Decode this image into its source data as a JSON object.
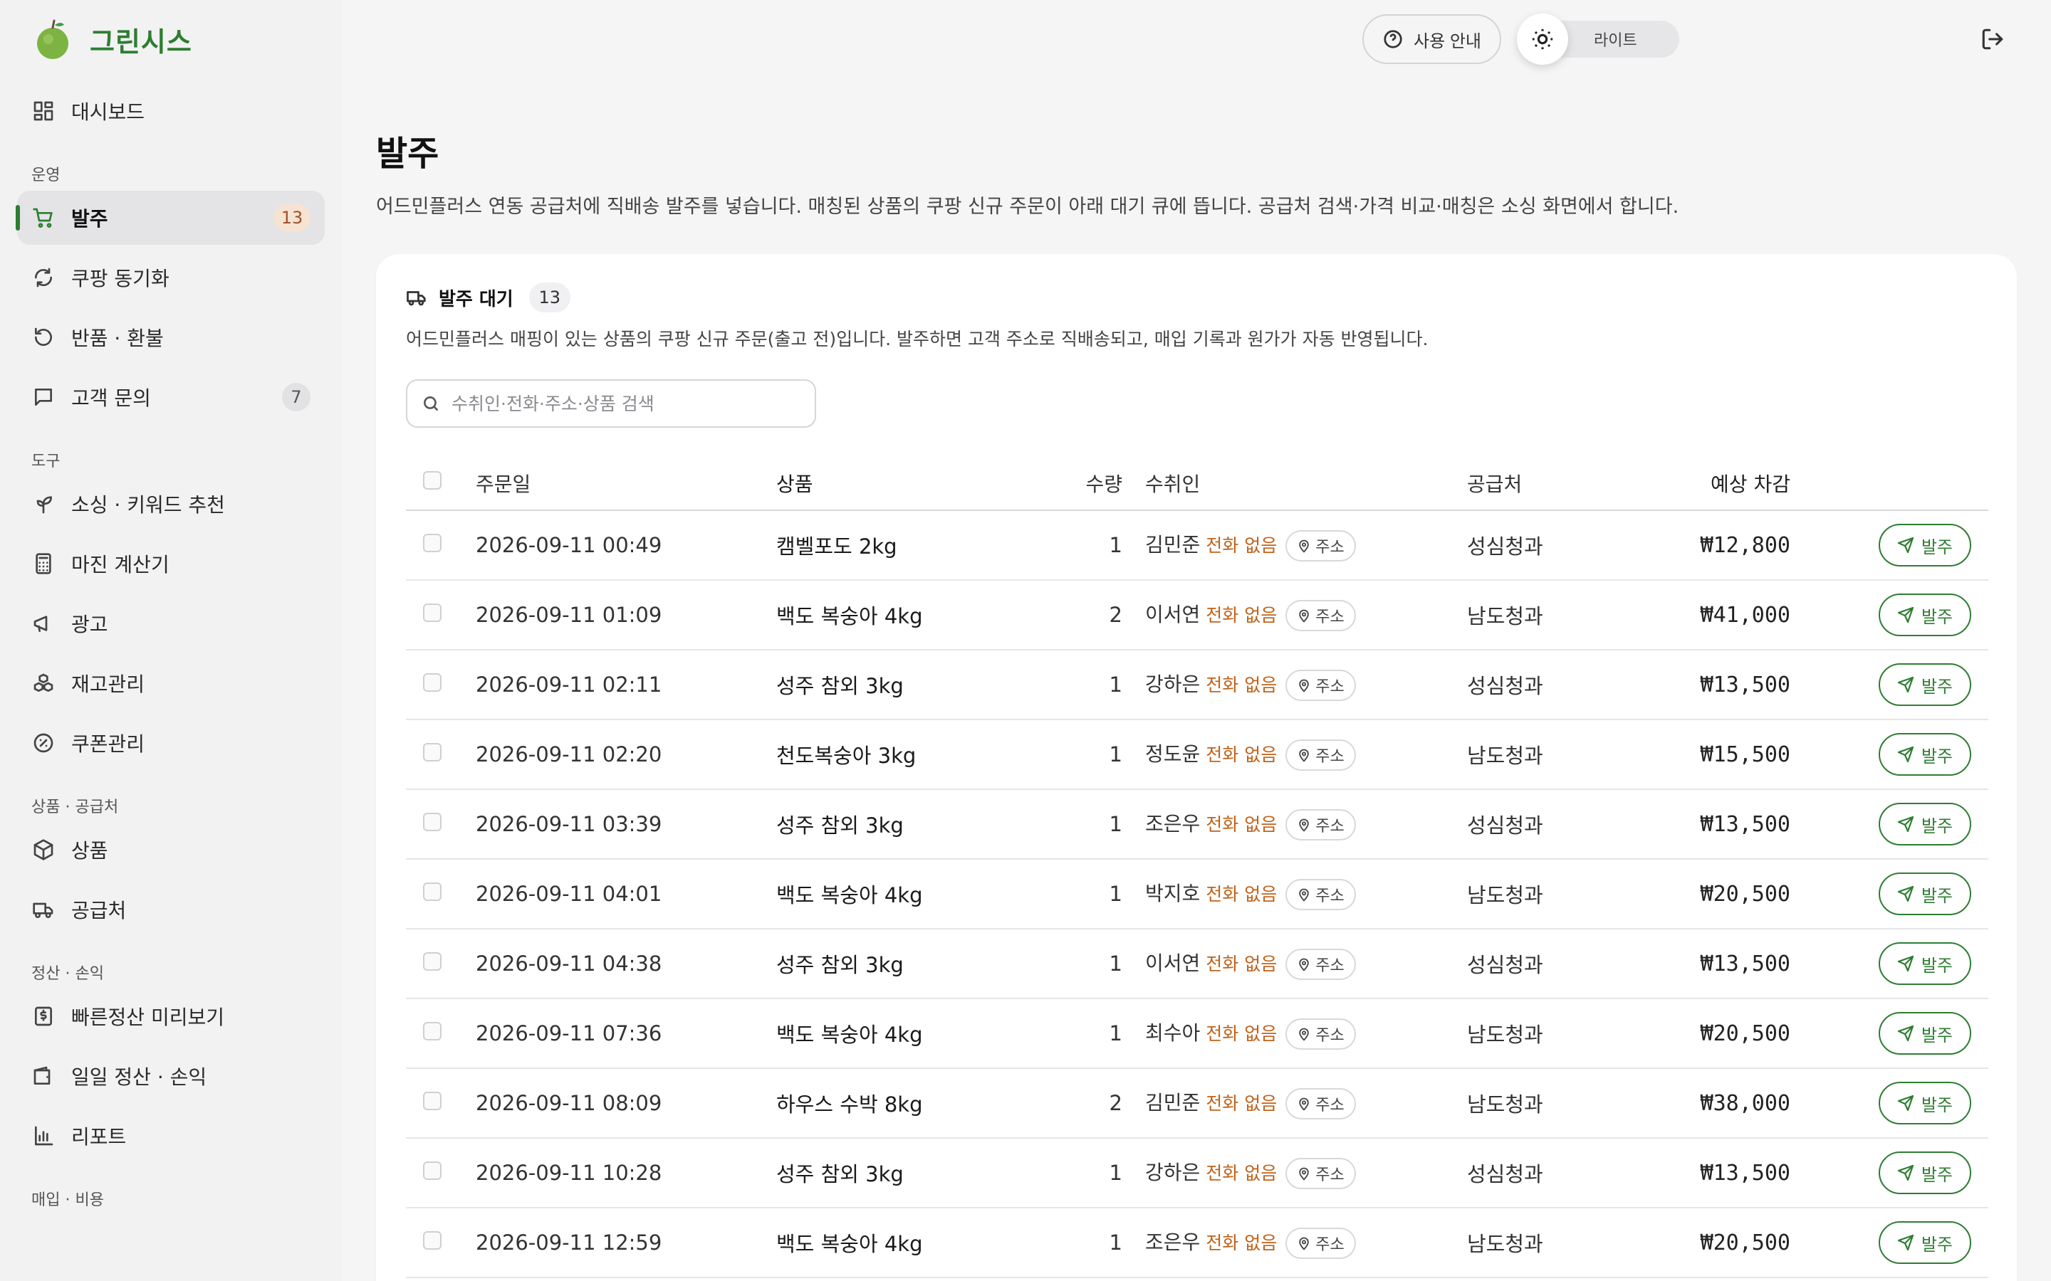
{
  "brand": {
    "name": "그린시스",
    "logo_icon": "apple-icon"
  },
  "topbar": {
    "help_label": "사용 안내",
    "theme_label": "라이트"
  },
  "sidebar": {
    "dashboard": "대시보드",
    "sections": {
      "ops": "운영",
      "tools": "도구",
      "products": "상품 · 공급처",
      "settle": "정산 · 손익",
      "purchase": "매입 · 비용"
    },
    "items": {
      "order": {
        "label": "발주",
        "badge": "13"
      },
      "coupang_sync": {
        "label": "쿠팡 동기화"
      },
      "returns": {
        "label": "반품 · 환불"
      },
      "inquiry": {
        "label": "고객 문의",
        "badge": "7"
      },
      "sourcing": {
        "label": "소싱 · 키워드 추천"
      },
      "margin": {
        "label": "마진 계산기"
      },
      "ads": {
        "label": "광고"
      },
      "inventory": {
        "label": "재고관리"
      },
      "coupon": {
        "label": "쿠폰관리"
      },
      "product": {
        "label": "상품"
      },
      "supplier": {
        "label": "공급처"
      },
      "quick_settle": {
        "label": "빠른정산 미리보기"
      },
      "daily_settle": {
        "label": "일일 정산 · 손익"
      },
      "report": {
        "label": "리포트"
      }
    }
  },
  "page": {
    "title": "발주",
    "description": "어드민플러스 연동 공급처에 직배송 발주를 넣습니다. 매칭된 상품의 쿠팡 신규 주문이 아래 대기 큐에 뜹니다. 공급처 검색·가격 비교·매칭은 소싱 화면에서 합니다."
  },
  "queue": {
    "title": "발주 대기",
    "count": "13",
    "description": "어드민플러스 매핑이 있는 상품의 쿠팡 신규 주문(출고 전)입니다. 발주하면 고객 주소로 직배송되고, 매입 기록과 원가가 자동 반영됩니다.",
    "search_placeholder": "수취인·전화·주소·상품 검색",
    "columns": {
      "date": "주문일",
      "product": "상품",
      "qty": "수량",
      "receiver": "수취인",
      "supplier": "공급처",
      "amount": "예상 차감"
    },
    "no_phone_label": "전화 없음",
    "address_label": "주소",
    "order_button_label": "발주",
    "rows": [
      {
        "date": "2026-09-11 00:49",
        "product": "캠벨포도 2kg",
        "qty": "1",
        "receiver": "김민준",
        "supplier": "성심청과",
        "amount": "₩12,800"
      },
      {
        "date": "2026-09-11 01:09",
        "product": "백도 복숭아 4kg",
        "qty": "2",
        "receiver": "이서연",
        "supplier": "남도청과",
        "amount": "₩41,000"
      },
      {
        "date": "2026-09-11 02:11",
        "product": "성주 참외 3kg",
        "qty": "1",
        "receiver": "강하은",
        "supplier": "성심청과",
        "amount": "₩13,500"
      },
      {
        "date": "2026-09-11 02:20",
        "product": "천도복숭아 3kg",
        "qty": "1",
        "receiver": "정도윤",
        "supplier": "남도청과",
        "amount": "₩15,500"
      },
      {
        "date": "2026-09-11 03:39",
        "product": "성주 참외 3kg",
        "qty": "1",
        "receiver": "조은우",
        "supplier": "성심청과",
        "amount": "₩13,500"
      },
      {
        "date": "2026-09-11 04:01",
        "product": "백도 복숭아 4kg",
        "qty": "1",
        "receiver": "박지호",
        "supplier": "남도청과",
        "amount": "₩20,500"
      },
      {
        "date": "2026-09-11 04:38",
        "product": "성주 참외 3kg",
        "qty": "1",
        "receiver": "이서연",
        "supplier": "성심청과",
        "amount": "₩13,500"
      },
      {
        "date": "2026-09-11 07:36",
        "product": "백도 복숭아 4kg",
        "qty": "1",
        "receiver": "최수아",
        "supplier": "남도청과",
        "amount": "₩20,500"
      },
      {
        "date": "2026-09-11 08:09",
        "product": "하우스 수박 8kg",
        "qty": "2",
        "receiver": "김민준",
        "supplier": "남도청과",
        "amount": "₩38,000"
      },
      {
        "date": "2026-09-11 10:28",
        "product": "성주 참외 3kg",
        "qty": "1",
        "receiver": "강하은",
        "supplier": "성심청과",
        "amount": "₩13,500"
      },
      {
        "date": "2026-09-11 12:59",
        "product": "백도 복숭아 4kg",
        "qty": "1",
        "receiver": "조은우",
        "supplier": "남도청과",
        "amount": "₩20,500"
      }
    ]
  },
  "colors": {
    "accent": "#2e7d32",
    "warning_text": "#c0621a",
    "badge_orange_bg": "#f6e3d2"
  }
}
